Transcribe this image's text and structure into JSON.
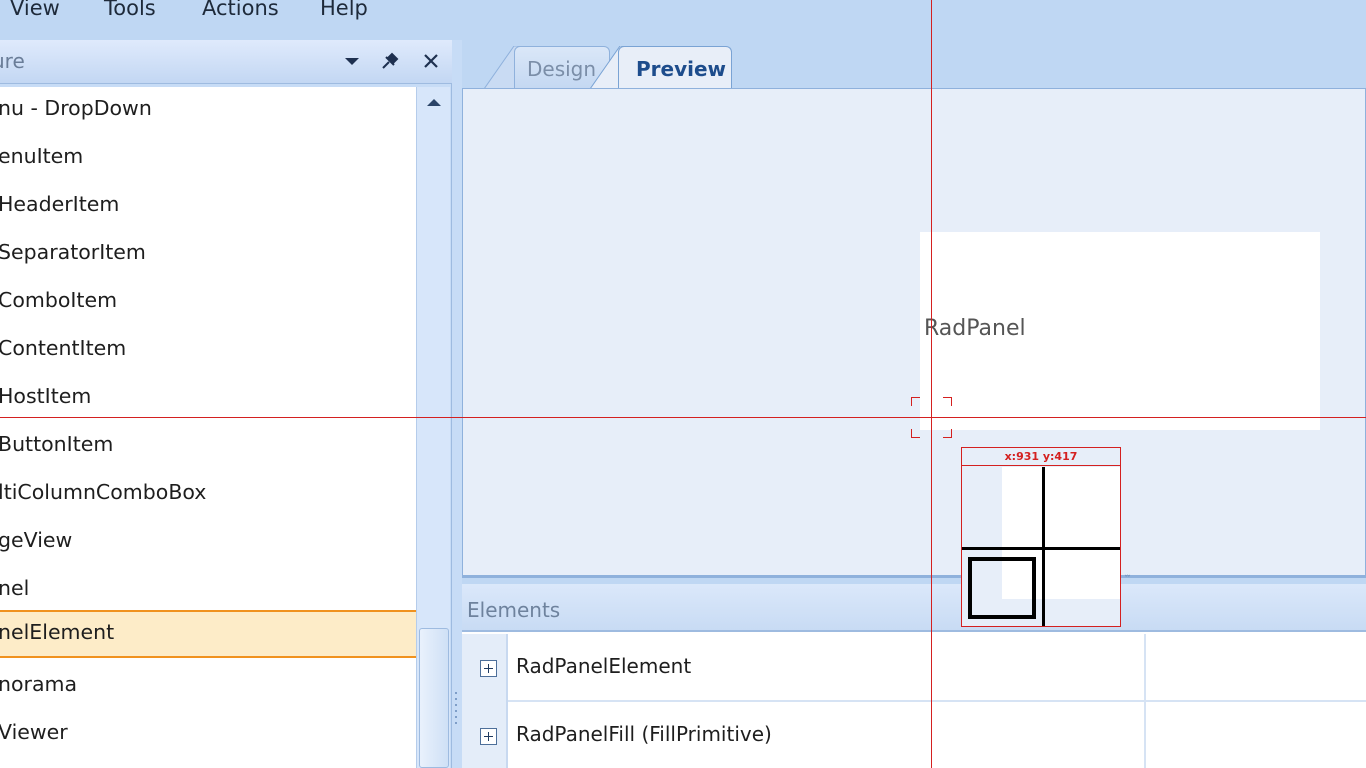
{
  "menu": {
    "items": [
      "View",
      "Tools",
      "Actions",
      "Help"
    ]
  },
  "left_panel": {
    "title": "ure",
    "dropdown_icon": "triangle-down",
    "pin_icon": "pushpin",
    "close_icon": "close-x",
    "tree_items": [
      {
        "label": "nu - DropDown",
        "selected": false
      },
      {
        "label": "enuItem",
        "selected": false
      },
      {
        "label": "HeaderItem",
        "selected": false
      },
      {
        "label": "SeparatorItem",
        "selected": false
      },
      {
        "label": "ComboItem",
        "selected": false
      },
      {
        "label": "ContentItem",
        "selected": false
      },
      {
        "label": "HostItem",
        "selected": false
      },
      {
        "label": "ButtonItem",
        "selected": false
      },
      {
        "label": "ltiColumnComboBox",
        "selected": false
      },
      {
        "label": "geView",
        "selected": false
      },
      {
        "label": "nel",
        "selected": false
      },
      {
        "label": "nelElement",
        "selected": true
      },
      {
        "label": "norama",
        "selected": false
      },
      {
        "label": "Viewer",
        "selected": false
      }
    ]
  },
  "tabs": {
    "design": "Design",
    "preview": "Preview",
    "active": "Preview"
  },
  "preview": {
    "radpanel_label": "RadPanel"
  },
  "elements": {
    "title": "Elements",
    "rows": [
      {
        "name": "RadPanelElement"
      },
      {
        "name": "RadPanelFill (FillPrimitive)"
      }
    ]
  },
  "magnifier": {
    "coords_label": "x:931  y:417"
  },
  "colors": {
    "crosshair": "#d42020",
    "selection_border": "#f0921f",
    "selection_fill": "#fdecc8",
    "chrome_blue": "#bfd7f3"
  }
}
